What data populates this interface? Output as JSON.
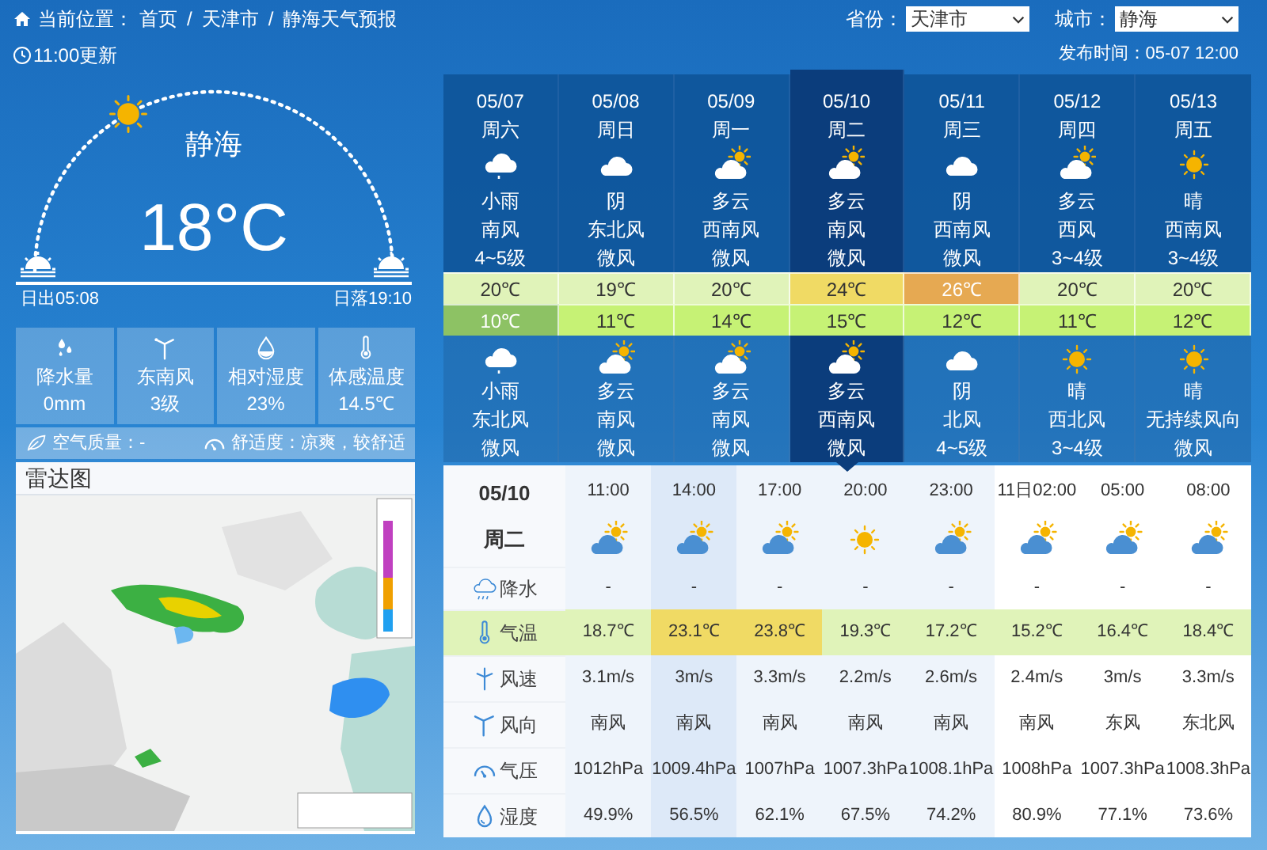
{
  "breadcrumb": {
    "label": "当前位置：",
    "separator": "/",
    "items": [
      "首页",
      "天津市",
      "静海天气预报"
    ]
  },
  "selectors": [
    {
      "label": "省份：",
      "value": "天津市"
    },
    {
      "label": "城市：",
      "value": "静海"
    }
  ],
  "update_time": "11:00更新",
  "publish_time": "发布时间：05-07 12:00",
  "current": {
    "city": "静海",
    "temperature": "18°C",
    "sunrise": "日出05:08",
    "sunset": "日落19:10"
  },
  "stats": [
    {
      "kind": "rain",
      "label": "降水量",
      "value": "0mm"
    },
    {
      "kind": "wind",
      "label": "东南风",
      "value": "3级"
    },
    {
      "kind": "humidity",
      "label": "相对湿度",
      "value": "23%"
    },
    {
      "kind": "feels",
      "label": "体感温度",
      "value": "14.5℃"
    }
  ],
  "air_quality": "空气质量：-",
  "comfort": "舒适度：凉爽，较舒适",
  "radar": {
    "title": "雷达图",
    "kind": "picture"
  },
  "daily": [
    {
      "date": "05/07",
      "weekday": "周六",
      "selected": false,
      "day": {
        "kind": "light_rain",
        "weather": "小雨",
        "wind": "南风",
        "level": "4~5级"
      },
      "high": {
        "text": "20℃",
        "color": "#e0f3b9"
      },
      "low": {
        "text": "10℃",
        "color": "#8dc264"
      },
      "night": {
        "kind": "light_rain",
        "weather": "小雨",
        "wind": "东北风",
        "level": "微风"
      }
    },
    {
      "date": "05/08",
      "weekday": "周日",
      "selected": false,
      "day": {
        "kind": "cloudy",
        "weather": "阴",
        "wind": "东北风",
        "level": "微风"
      },
      "high": {
        "text": "19℃",
        "color": "#e0f3b9"
      },
      "low": {
        "text": "11℃",
        "color": "#c6f275"
      },
      "night": {
        "kind": "partly_cloudy",
        "weather": "多云",
        "wind": "南风",
        "level": "微风"
      }
    },
    {
      "date": "05/09",
      "weekday": "周一",
      "selected": false,
      "day": {
        "kind": "partly_cloudy",
        "weather": "多云",
        "wind": "西南风",
        "level": "微风"
      },
      "high": {
        "text": "20℃",
        "color": "#e0f3b9"
      },
      "low": {
        "text": "14℃",
        "color": "#c6f275"
      },
      "night": {
        "kind": "partly_cloudy",
        "weather": "多云",
        "wind": "南风",
        "level": "微风"
      }
    },
    {
      "date": "05/10",
      "weekday": "周二",
      "selected": true,
      "day": {
        "kind": "partly_cloudy",
        "weather": "多云",
        "wind": "南风",
        "level": "微风"
      },
      "high": {
        "text": "24℃",
        "color": "#f0da64"
      },
      "low": {
        "text": "15℃",
        "color": "#c6f275"
      },
      "night": {
        "kind": "partly_cloudy",
        "weather": "多云",
        "wind": "西南风",
        "level": "微风"
      }
    },
    {
      "date": "05/11",
      "weekday": "周三",
      "selected": false,
      "day": {
        "kind": "cloudy",
        "weather": "阴",
        "wind": "西南风",
        "level": "微风"
      },
      "high": {
        "text": "26℃",
        "color": "#e6a952"
      },
      "low": {
        "text": "12℃",
        "color": "#c6f275"
      },
      "night": {
        "kind": "cloudy",
        "weather": "阴",
        "wind": "北风",
        "level": "4~5级"
      }
    },
    {
      "date": "05/12",
      "weekday": "周四",
      "selected": false,
      "day": {
        "kind": "partly_cloudy",
        "weather": "多云",
        "wind": "西风",
        "level": "3~4级"
      },
      "high": {
        "text": "20℃",
        "color": "#e0f3b9"
      },
      "low": {
        "text": "11℃",
        "color": "#c6f275"
      },
      "night": {
        "kind": "sunny",
        "weather": "晴",
        "wind": "西北风",
        "level": "3~4级"
      }
    },
    {
      "date": "05/13",
      "weekday": "周五",
      "selected": false,
      "day": {
        "kind": "sunny",
        "weather": "晴",
        "wind": "西南风",
        "level": "3~4级"
      },
      "high": {
        "text": "20℃",
        "color": "#e0f3b9"
      },
      "low": {
        "text": "12℃",
        "color": "#c6f275"
      },
      "night": {
        "kind": "sunny",
        "weather": "晴",
        "wind": "无持续风向",
        "level": "微风"
      }
    }
  ],
  "hourly": {
    "date": "05/10",
    "weekday": "周二",
    "rows": [
      {
        "kind": "rain",
        "label": "降水"
      },
      {
        "kind": "temp",
        "label": "气温"
      },
      {
        "kind": "speed",
        "label": "风速"
      },
      {
        "kind": "direction",
        "label": "风向"
      },
      {
        "kind": "pressure",
        "label": "气压"
      },
      {
        "kind": "humidity",
        "label": "湿度"
      }
    ],
    "columns": [
      {
        "time": "11:00",
        "kind": "partly_cloudy",
        "shaded": true,
        "current": false,
        "rain": "-",
        "temp": "18.7℃",
        "color": "#e0f3b9",
        "speed": "3.1m/s",
        "direction": "南风",
        "pressure": "1012hPa",
        "humidity": "49.9%"
      },
      {
        "time": "14:00",
        "kind": "partly_cloudy",
        "shaded": true,
        "current": true,
        "rain": "-",
        "temp": "23.1℃",
        "color": "#f0da64",
        "speed": "3m/s",
        "direction": "南风",
        "pressure": "1009.4hPa",
        "humidity": "56.5%"
      },
      {
        "time": "17:00",
        "kind": "partly_cloudy",
        "shaded": true,
        "current": false,
        "rain": "-",
        "temp": "23.8℃",
        "color": "#f0da64",
        "speed": "3.3m/s",
        "direction": "南风",
        "pressure": "1007hPa",
        "humidity": "62.1%"
      },
      {
        "time": "20:00",
        "kind": "sunny",
        "shaded": true,
        "current": false,
        "rain": "-",
        "temp": "19.3℃",
        "color": "#e0f3b9",
        "speed": "2.2m/s",
        "direction": "南风",
        "pressure": "1007.3hPa",
        "humidity": "67.5%"
      },
      {
        "time": "23:00",
        "kind": "partly_cloudy",
        "shaded": true,
        "current": false,
        "rain": "-",
        "temp": "17.2℃",
        "color": "#e0f3b9",
        "speed": "2.6m/s",
        "direction": "南风",
        "pressure": "1008.1hPa",
        "humidity": "74.2%"
      },
      {
        "time": "11日02:00",
        "kind": "partly_cloudy",
        "shaded": false,
        "current": false,
        "rain": "-",
        "temp": "15.2℃",
        "color": "#e0f3b9",
        "speed": "2.4m/s",
        "direction": "南风",
        "pressure": "1008hPa",
        "humidity": "80.9%"
      },
      {
        "time": "05:00",
        "kind": "partly_cloudy",
        "shaded": false,
        "current": false,
        "rain": "-",
        "temp": "16.4℃",
        "color": "#e0f3b9",
        "speed": "3m/s",
        "direction": "东风",
        "pressure": "1007.3hPa",
        "humidity": "77.1%"
      },
      {
        "time": "08:00",
        "kind": "partly_cloudy",
        "shaded": false,
        "current": false,
        "rain": "-",
        "temp": "18.4℃",
        "color": "#e0f3b9",
        "speed": "3.3m/s",
        "direction": "东北风",
        "pressure": "1008.3hPa",
        "humidity": "73.6%"
      }
    ]
  }
}
